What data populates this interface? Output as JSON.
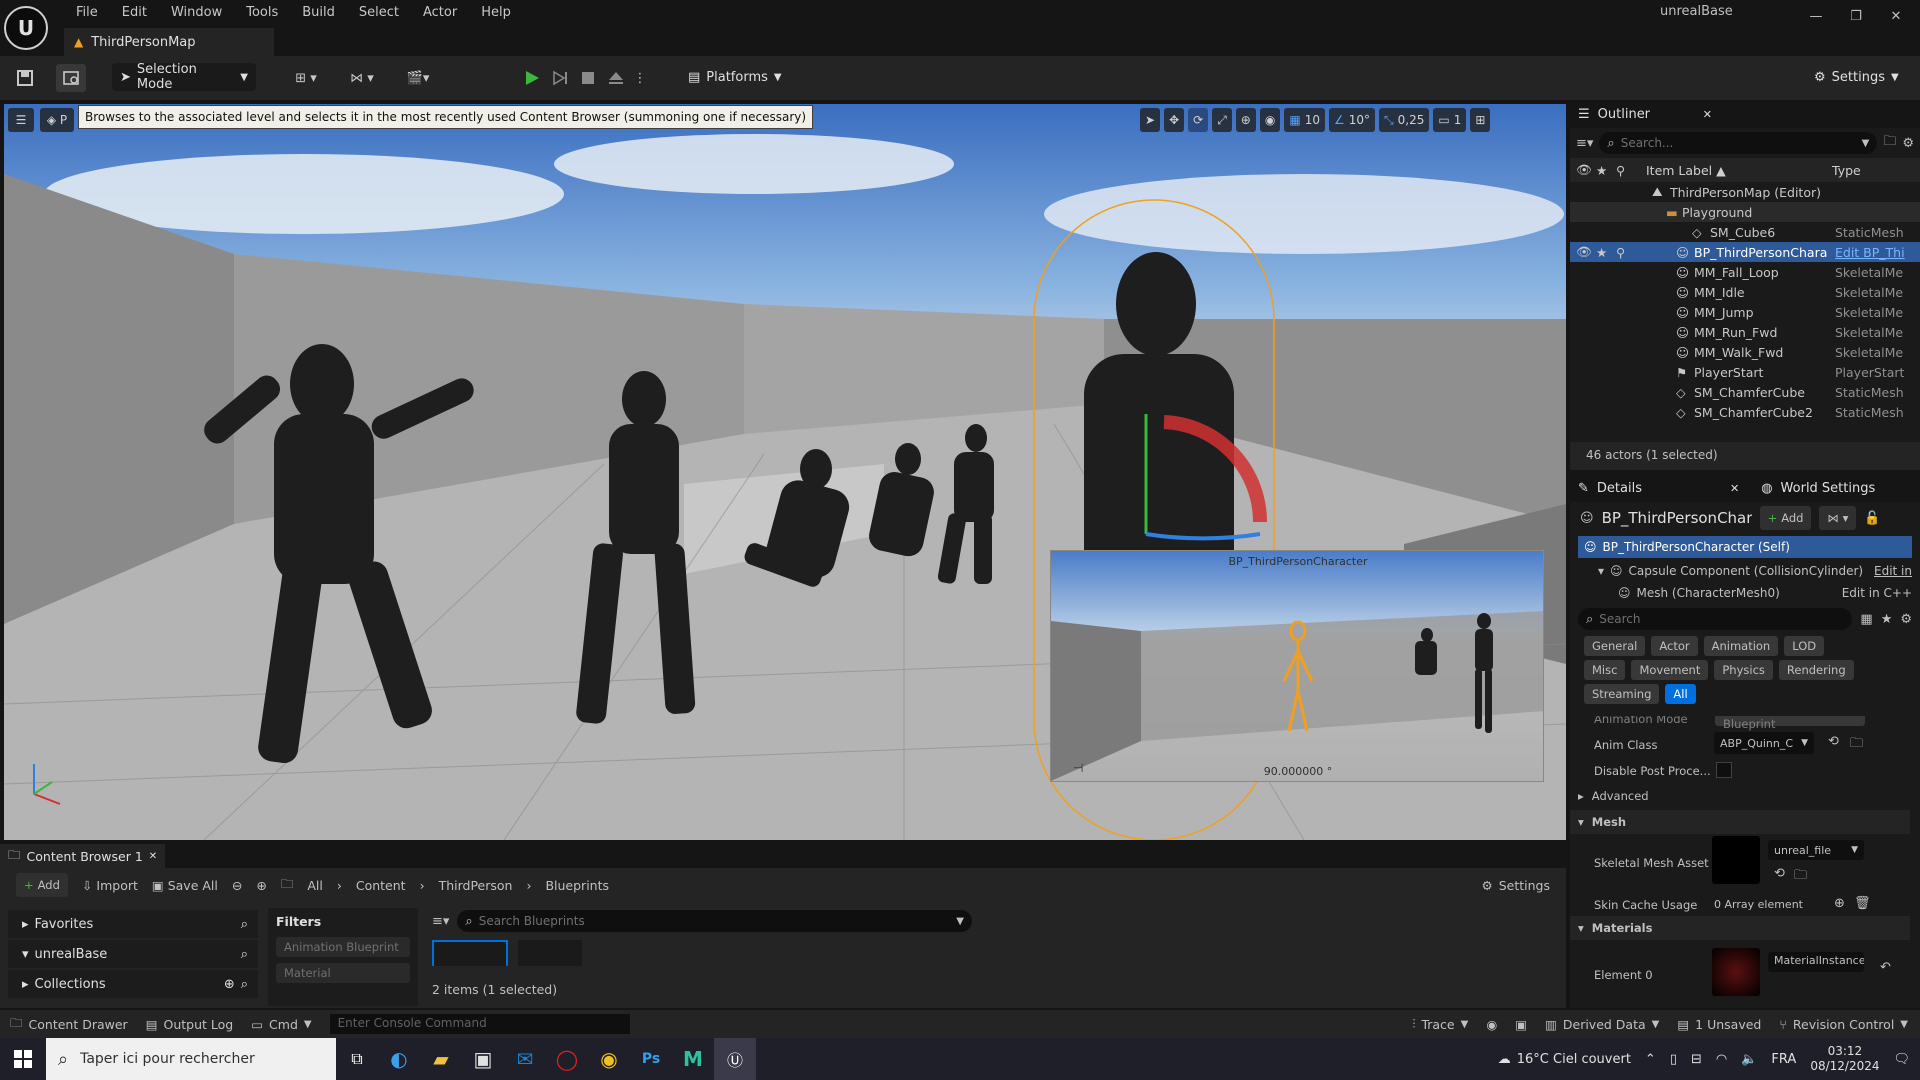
{
  "app": {
    "name": "unrealBase",
    "logo_text": "U",
    "map_tab": "ThirdPersonMap",
    "menu": [
      "File",
      "Edit",
      "Window",
      "Tools",
      "Build",
      "Select",
      "Actor",
      "Help"
    ]
  },
  "toolbar": {
    "selection_mode": "Selection Mode",
    "platforms": "Platforms",
    "settings": "Settings"
  },
  "viewport": {
    "tooltip": "Browses to the associated level and selects it in the most recently used Content Browser (summoning one if necessary)",
    "grid_snap": "10",
    "rotation_snap": "10°",
    "scale_snap": "0,25",
    "camera_speed": "1",
    "pip_title": "BP_ThirdPersonCharacter",
    "pip_fov": "90.000000 °"
  },
  "outliner": {
    "title": "Outliner",
    "search_placeholder": "Search...",
    "col_label": "Item Label ▲",
    "col_type": "Type",
    "items": [
      {
        "label": "ThirdPersonMap (Editor)",
        "type": ""
      },
      {
        "label": "Playground",
        "type": ""
      },
      {
        "label": "SM_Cube6",
        "type": "StaticMesh"
      },
      {
        "label": "BP_ThirdPersonChara",
        "type": "Edit BP_Thi"
      },
      {
        "label": "MM_Fall_Loop",
        "type": "SkeletalMe"
      },
      {
        "label": "MM_Idle",
        "type": "SkeletalMe"
      },
      {
        "label": "MM_Jump",
        "type": "SkeletalMe"
      },
      {
        "label": "MM_Run_Fwd",
        "type": "SkeletalMe"
      },
      {
        "label": "MM_Walk_Fwd",
        "type": "SkeletalMe"
      },
      {
        "label": "PlayerStart",
        "type": "PlayerStart"
      },
      {
        "label": "SM_ChamferCube",
        "type": "StaticMesh"
      },
      {
        "label": "SM_ChamferCube2",
        "type": "StaticMesh"
      }
    ],
    "footer": "46 actors (1 selected)"
  },
  "details": {
    "tab_details": "Details",
    "tab_world": "World Settings",
    "actor_name": "BP_ThirdPersonChara",
    "add_label": "Add",
    "components": [
      {
        "label": "BP_ThirdPersonCharacter (Self)",
        "action": ""
      },
      {
        "label": "Capsule Component (CollisionCylinder)",
        "action": "Edit in"
      },
      {
        "label": "Mesh (CharacterMesh0)",
        "action": "Edit in C++"
      }
    ],
    "search_placeholder": "Search",
    "filters_row1": [
      "General",
      "Actor",
      "Animation",
      "LOD"
    ],
    "filters_row2": [
      "Misc",
      "Movement",
      "Physics",
      "Rendering"
    ],
    "filters_row3": [
      "Streaming",
      "All"
    ],
    "active_filter": "All",
    "anim_mode_label": "Animation Mode",
    "anim_mode_value": "Use Animation Blueprint",
    "anim_class_label": "Anim Class",
    "anim_class_value": "ABP_Quinn_C",
    "disable_pp_label": "Disable Post Proce...",
    "advanced_label": "Advanced",
    "mesh_section": "Mesh",
    "skeletal_mesh_label": "Skeletal Mesh Asset",
    "skeletal_mesh_value": "unreal_file",
    "skin_cache_label": "Skin Cache Usage",
    "skin_cache_value": "0 Array element",
    "materials_section": "Materials",
    "element0_label": "Element 0",
    "element0_value": "MaterialInstanceD"
  },
  "content_browser": {
    "tab": "Content Browser 1",
    "add": "Add",
    "import": "Import",
    "save_all": "Save All",
    "breadcrumb": [
      "All",
      "Content",
      "ThirdPerson",
      "Blueprints"
    ],
    "settings": "Settings",
    "favorites": "Favorites",
    "project": "unrealBase",
    "collections": "Collections",
    "filters_title": "Filters",
    "filter_items": [
      "Animation Blueprint",
      "Material"
    ],
    "search_placeholder": "Search Blueprints",
    "status": "2 items (1 selected)"
  },
  "statusbar": {
    "content_drawer": "Content Drawer",
    "output_log": "Output Log",
    "cmd": "Cmd",
    "console_placeholder": "Enter Console Command",
    "trace": "Trace",
    "derived_data": "Derived Data",
    "unsaved": "1 Unsaved",
    "revision_control": "Revision Control"
  },
  "taskbar": {
    "search_placeholder": "Taper ici pour rechercher",
    "weather": "16°C  Ciel couvert",
    "lang": "FRA",
    "time": "03:12",
    "date": "08/12/2024"
  },
  "colors": {
    "accent": "#0070e0",
    "selection": "#2e5a9a",
    "play_green": "#3cb83c",
    "orange_outline": "#f0a020"
  }
}
